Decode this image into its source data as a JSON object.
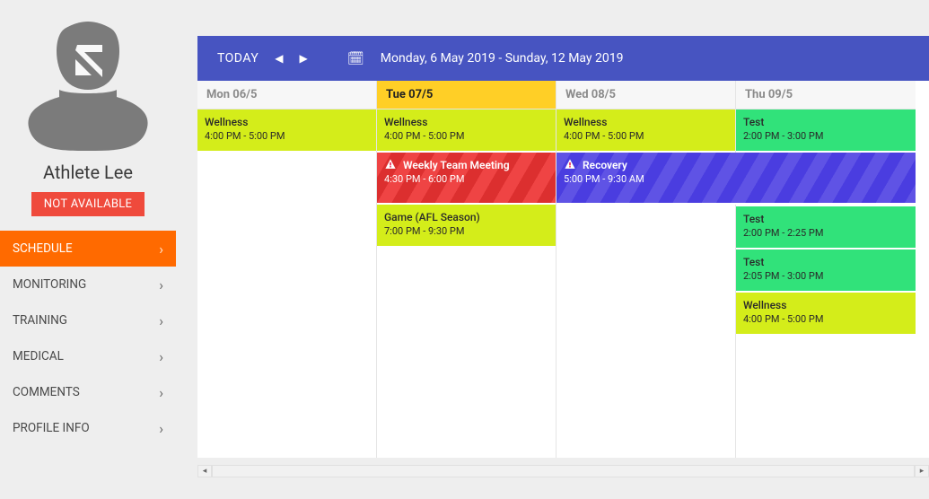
{
  "user": {
    "name": "Athlete Lee",
    "status": "NOT AVAILABLE"
  },
  "nav": {
    "items": [
      {
        "label": "SCHEDULE",
        "key": "schedule",
        "active": true
      },
      {
        "label": "MONITORING",
        "key": "monitoring",
        "active": false
      },
      {
        "label": "TRAINING",
        "key": "training",
        "active": false
      },
      {
        "label": "MEDICAL",
        "key": "medical",
        "active": false
      },
      {
        "label": "COMMENTS",
        "key": "comments",
        "active": false
      },
      {
        "label": "PROFILE INFO",
        "key": "profile-info",
        "active": false
      }
    ]
  },
  "header": {
    "today": "TODAY",
    "range": "Monday, 6 May 2019 - Sunday, 12 May 2019"
  },
  "days": [
    {
      "label": "Mon 06/5",
      "highlighted": false,
      "events": [
        {
          "title": "Wellness",
          "time": "4:00 PM - 5:00 PM",
          "color": "lime"
        }
      ]
    },
    {
      "label": "Tue 07/5",
      "highlighted": true,
      "events": [
        {
          "title": "Wellness",
          "time": "4:00 PM - 5:00 PM",
          "color": "lime"
        },
        {
          "title": "Weekly Team Meeting",
          "time": "4:30 PM - 6:00 PM",
          "color": "red",
          "alert": true
        },
        {
          "title": "Game (AFL Season)",
          "time": "7:00 PM - 9:30 PM",
          "color": "yellow"
        }
      ]
    },
    {
      "label": "Wed 08/5",
      "highlighted": false,
      "events": [
        {
          "title": "Wellness",
          "time": "4:00 PM - 5:00 PM",
          "color": "lime"
        },
        {
          "title": "Recovery",
          "time": "5:00 PM - 9:30 AM",
          "color": "purple",
          "alert": true,
          "span": 2
        }
      ]
    },
    {
      "label": "Thu 09/5",
      "highlighted": false,
      "events": [
        {
          "title": "Test",
          "time": "2:00 PM - 3:00 PM",
          "color": "green"
        },
        {
          "title": "",
          "time": "",
          "color": "spacer"
        },
        {
          "title": "Test",
          "time": "2:00 PM - 2:25 PM",
          "color": "green"
        },
        {
          "title": "Test",
          "time": "2:05 PM - 3:00 PM",
          "color": "green"
        },
        {
          "title": "Wellness",
          "time": "4:00 PM - 5:00 PM",
          "color": "lime"
        }
      ]
    }
  ],
  "colors": {
    "accent": "#4754c1",
    "active": "#ff6a00",
    "danger": "#ef4a3c"
  }
}
